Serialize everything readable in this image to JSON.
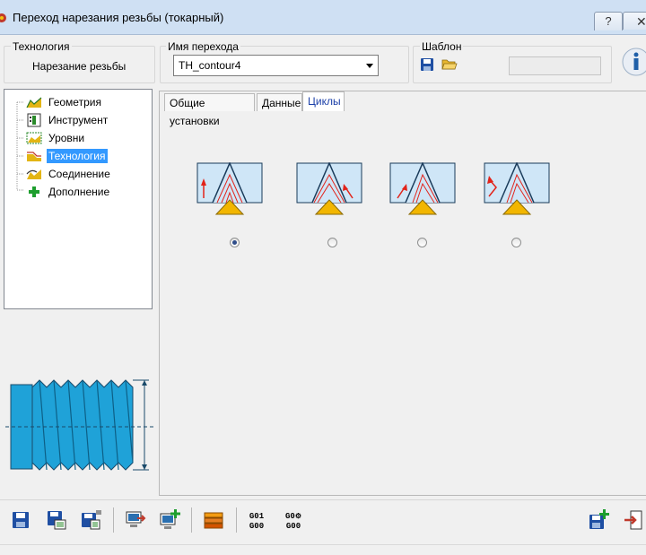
{
  "window": {
    "title": "Переход нарезания резьбы (токарный)",
    "help_label": "?",
    "close_label": "✕"
  },
  "header": {
    "technology": {
      "label": "Технология",
      "value": "Нарезание резьбы"
    },
    "transition_name": {
      "label": "Имя перехода",
      "value": "TH_contour4"
    },
    "template": {
      "label": "Шаблон",
      "value": ""
    }
  },
  "tree": {
    "items": [
      {
        "label": "Геометрия",
        "icon": "geometry-icon",
        "selected": false
      },
      {
        "label": "Инструмент",
        "icon": "tool-icon",
        "selected": false
      },
      {
        "label": "Уровни",
        "icon": "levels-icon",
        "selected": false
      },
      {
        "label": "Технология",
        "icon": "technology-icon",
        "selected": true
      },
      {
        "label": "Соединение",
        "icon": "connection-icon",
        "selected": false
      },
      {
        "label": "Дополнение",
        "icon": "addition-icon",
        "selected": false
      }
    ]
  },
  "tabs": [
    {
      "label": "Общие установки",
      "active": false
    },
    {
      "label": "Данные",
      "active": false
    },
    {
      "label": "Циклы",
      "active": true
    }
  ],
  "cycles": {
    "options": [
      {
        "name": "cycle-1",
        "selected": true
      },
      {
        "name": "cycle-2",
        "selected": false
      },
      {
        "name": "cycle-3",
        "selected": false
      },
      {
        "name": "cycle-4",
        "selected": false
      }
    ]
  },
  "toolbar": {
    "gcode_1": {
      "top": "G01",
      "bottom": "G00"
    },
    "gcode_2": {
      "top": "G0",
      "bottom": "G00"
    }
  },
  "colors": {
    "accent": "#3399ff",
    "thread_blue": "#1fa2d8",
    "insert_yellow": "#f2b600",
    "cut_lines_red": "#e2231a"
  }
}
